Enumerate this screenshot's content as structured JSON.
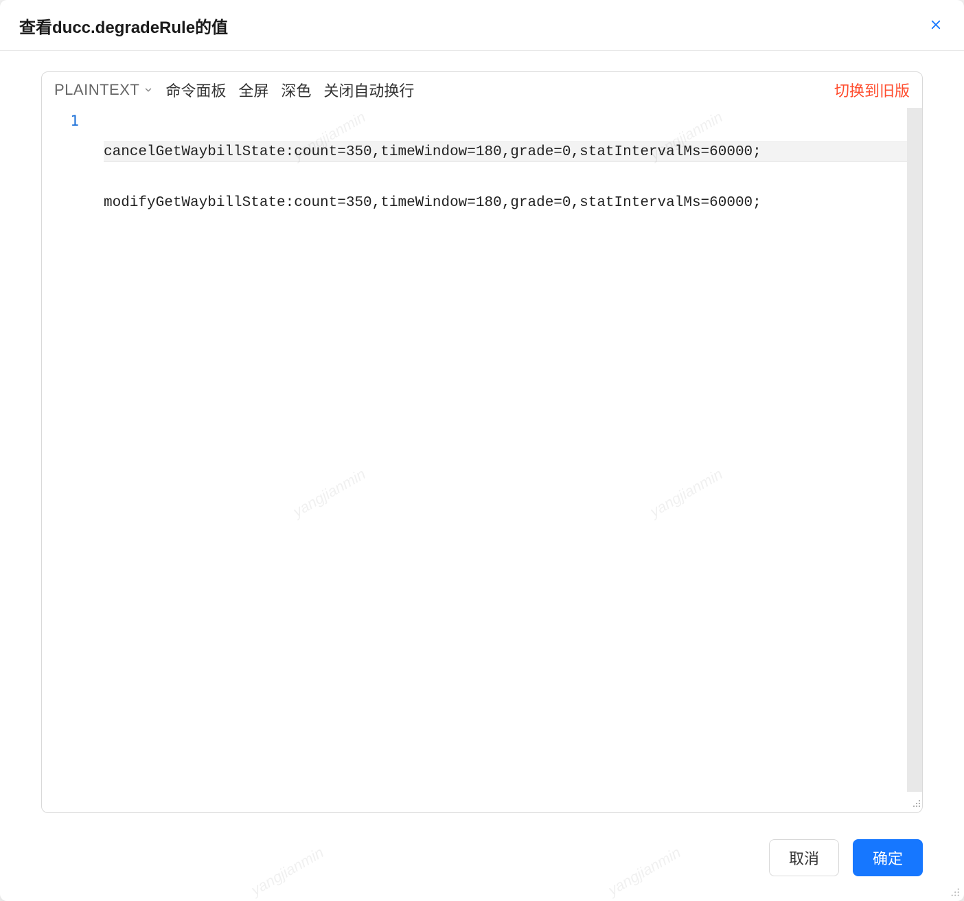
{
  "modal": {
    "title": "查看ducc.degradeRule的值"
  },
  "toolbar": {
    "language": "PLAINTEXT",
    "command_panel": "命令面板",
    "fullscreen": "全屏",
    "dark_mode": "深色",
    "toggle_wrap": "关闭自动换行",
    "switch_old": "切换到旧版"
  },
  "editor": {
    "line_start": "1",
    "lines": [
      "cancelGetWaybillState:count=350,timeWindow=180,grade=0,statIntervalMs=60000;",
      "modifyGetWaybillState:count=350,timeWindow=180,grade=0,statIntervalMs=60000;"
    ]
  },
  "footer": {
    "cancel": "取消",
    "confirm": "确定"
  },
  "watermark": "yangjianmin"
}
